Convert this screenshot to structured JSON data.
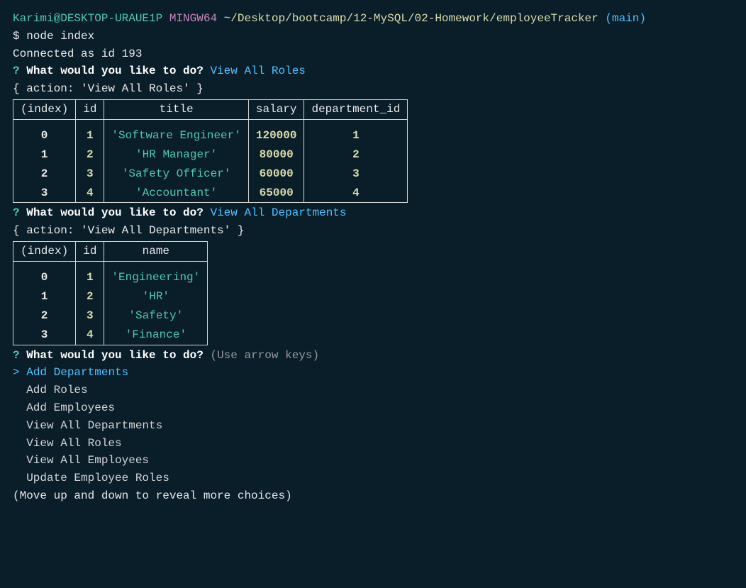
{
  "prompt": {
    "user": "Karimi@DESKTOP-URAUE1P",
    "env": "MINGW64",
    "path": "~/Desktop/bootcamp/12-MySQL/02-Homework/employeeTracker",
    "branch": "(main)"
  },
  "command": "$ node index",
  "connected": "Connected as id 193",
  "question_mark": "?",
  "question": "What would you like to do?",
  "answer1": "View All Roles",
  "action1_line": "{ action: 'View All Roles' }",
  "roles_table": {
    "headers": [
      "(index)",
      "id",
      "title",
      "salary",
      "department_id"
    ],
    "rows": [
      {
        "index": "0",
        "id": "1",
        "title": "'Software Engineer'",
        "salary": "120000",
        "department_id": "1"
      },
      {
        "index": "1",
        "id": "2",
        "title": "'HR Manager'",
        "salary": "80000",
        "department_id": "2"
      },
      {
        "index": "2",
        "id": "3",
        "title": "'Safety Officer'",
        "salary": "60000",
        "department_id": "3"
      },
      {
        "index": "3",
        "id": "4",
        "title": "'Accountant'",
        "salary": "65000",
        "department_id": "4"
      }
    ]
  },
  "answer2": "View All Departments",
  "action2_line": "{ action: 'View All Departments' }",
  "depts_table": {
    "headers": [
      "(index)",
      "id",
      "name"
    ],
    "rows": [
      {
        "index": "0",
        "id": "1",
        "name": "'Engineering'"
      },
      {
        "index": "1",
        "id": "2",
        "name": "'HR'"
      },
      {
        "index": "2",
        "id": "3",
        "name": "'Safety'"
      },
      {
        "index": "3",
        "id": "4",
        "name": "'Finance'"
      }
    ]
  },
  "arrow_hint": "(Use arrow keys)",
  "pointer": ">",
  "menu": {
    "items": [
      "Add Departments",
      "Add Roles",
      "Add Employees",
      "View All Departments",
      "View All Roles",
      "View All Employees",
      "Update Employee Roles"
    ]
  },
  "move_hint": "(Move up and down to reveal more choices)"
}
